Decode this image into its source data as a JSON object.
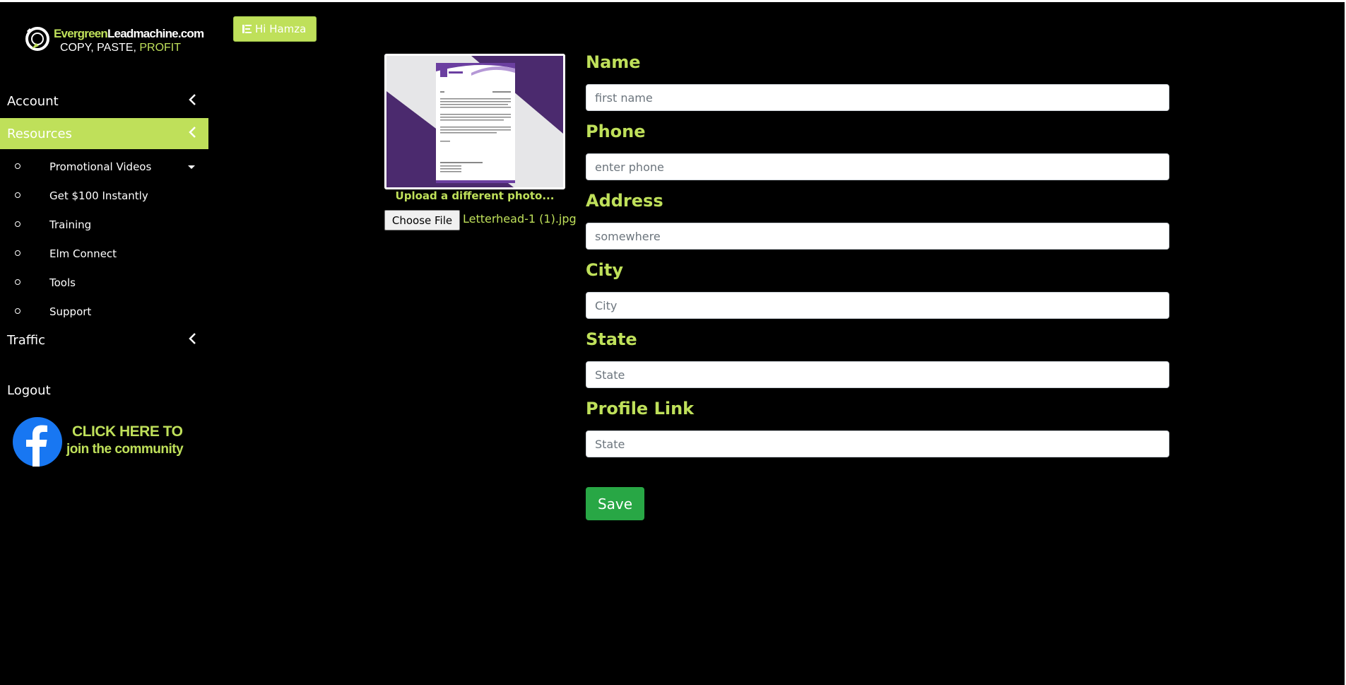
{
  "brand": {
    "logo_part1": "Evergreen",
    "logo_part2": "Leadmachine.com",
    "tagline_part1": "COPY, PASTE, ",
    "tagline_part2": "PROFIT"
  },
  "sidebar": {
    "account_label": "Account",
    "resources_label": "Resources",
    "resources_items": [
      {
        "label": "Promotional Videos"
      },
      {
        "label": "Get $100 Instantly"
      },
      {
        "label": "Training"
      },
      {
        "label": "Elm Connect"
      },
      {
        "label": "Tools"
      },
      {
        "label": "Support"
      }
    ],
    "traffic_label": "Traffic",
    "logout_label": "Logout",
    "fb_line1": "CLICK HERE TO",
    "fb_line2": "join the community"
  },
  "header": {
    "greeting": "Hi Hamza"
  },
  "photo": {
    "upload_label": "Upload a different photo...",
    "choose_file_label": "Choose File",
    "file_name": "Letterhead-1 (1).jpg"
  },
  "form": {
    "name_label": "Name",
    "name_placeholder": "first name",
    "phone_label": "Phone",
    "phone_placeholder": "enter phone",
    "address_label": "Address",
    "address_placeholder": "somewhere",
    "city_label": "City",
    "city_placeholder": "City",
    "state_label": "State",
    "state_placeholder": "State",
    "profile_label": "Profile Link",
    "profile_placeholder": "State",
    "save_label": "Save"
  },
  "colors": {
    "accent": "#bfe05a",
    "save": "#28a745",
    "background": "#000000",
    "facebook": "#1877f2"
  },
  "icons": [
    "evergreen-logo-icon",
    "chevron-left-icon",
    "caret-down-icon",
    "menu-icon",
    "facebook-icon"
  ]
}
